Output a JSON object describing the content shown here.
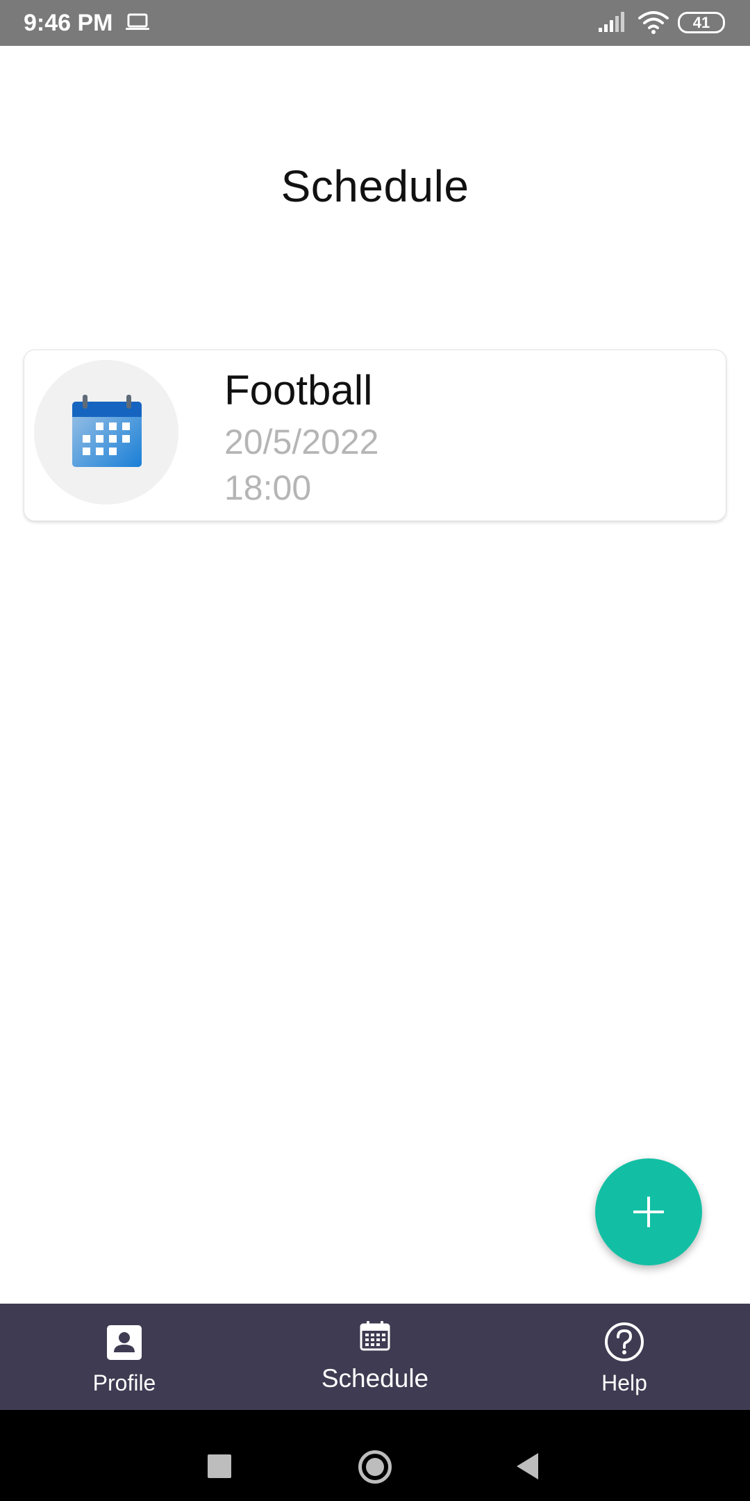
{
  "status_bar": {
    "time": "9:46 PM",
    "battery": "41",
    "icons": [
      "laptop-icon",
      "signal-icon",
      "wifi-icon",
      "battery-icon"
    ]
  },
  "page": {
    "title": "Schedule"
  },
  "schedule": [
    {
      "title": "Football",
      "date": "20/5/2022",
      "time": "18:00",
      "icon": "calendar-icon"
    }
  ],
  "fab": {
    "icon": "plus-icon",
    "color": "#12bfa4"
  },
  "bottom_nav": {
    "background": "#3f3b52",
    "items": [
      {
        "label": "Profile",
        "icon": "profile-icon"
      },
      {
        "label": "Schedule",
        "icon": "calendar-icon",
        "selected": true
      },
      {
        "label": "Help",
        "icon": "help-icon"
      }
    ]
  },
  "system_nav": {
    "buttons": [
      "recents-button",
      "home-button",
      "back-button"
    ]
  }
}
